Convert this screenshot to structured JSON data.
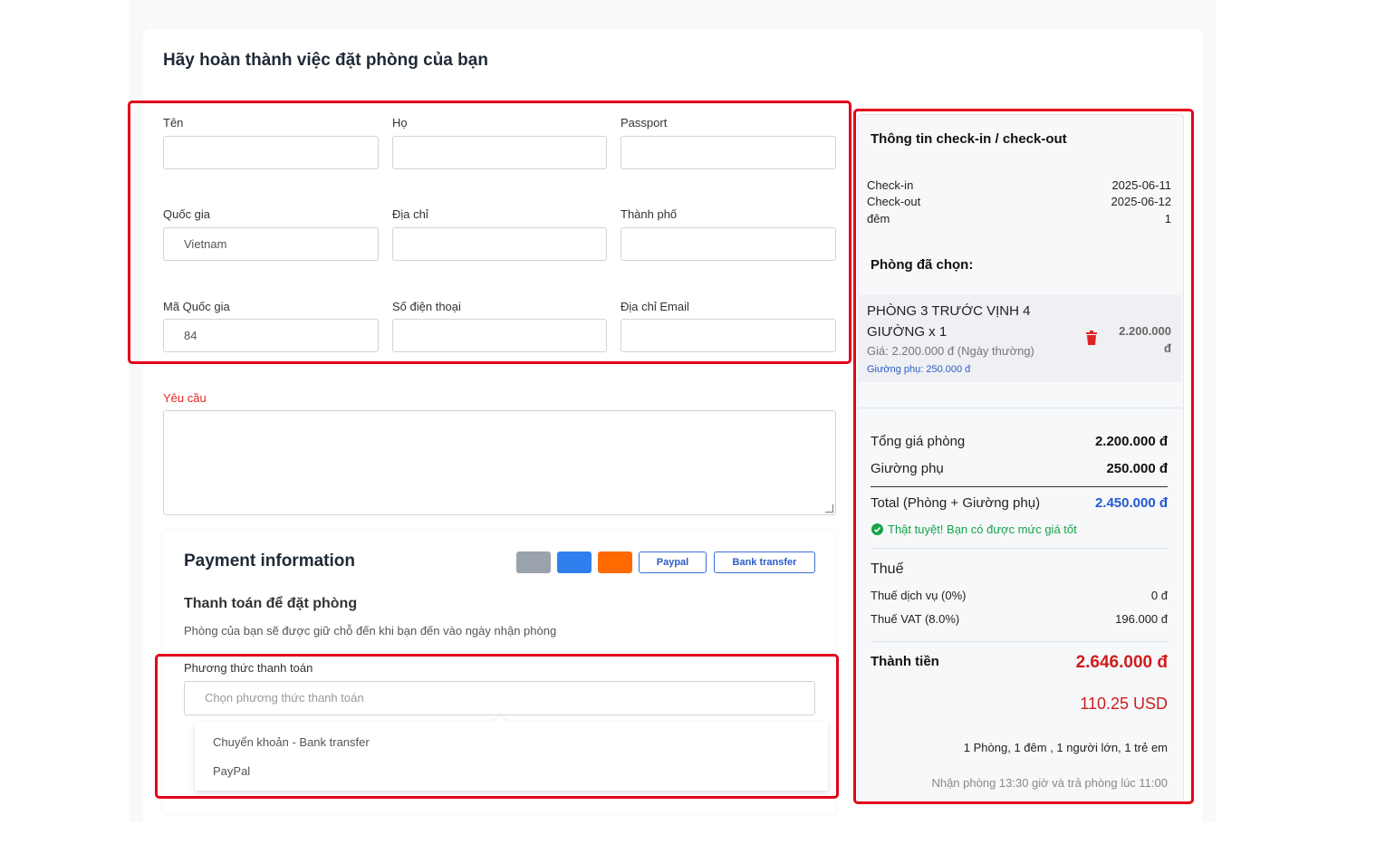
{
  "page": {
    "title": "Hãy hoàn thành việc đặt phòng của bạn"
  },
  "form": {
    "first_name": {
      "label": "Tên",
      "value": ""
    },
    "last_name": {
      "label": "Họ",
      "value": ""
    },
    "passport": {
      "label": "Passport",
      "value": ""
    },
    "country": {
      "label": "Quốc gia",
      "value": "Vietnam"
    },
    "address": {
      "label": "Địa chỉ",
      "value": ""
    },
    "city": {
      "label": "Thành phố",
      "value": ""
    },
    "country_code": {
      "label": "Mã Quốc gia",
      "value": "84"
    },
    "phone": {
      "label": "Số điện thoại",
      "value": ""
    },
    "email": {
      "label": "Địa chỉ Email",
      "value": ""
    },
    "request": {
      "label": "Yêu cầu",
      "value": ""
    }
  },
  "payment": {
    "heading": "Payment information",
    "methods_chips": [
      "Paypal",
      "Bank transfer"
    ],
    "subheading": "Thanh toán để đặt phòng",
    "note": "Phòng của bạn sẽ được giữ chỗ đến khi bạn đến vào ngày nhận phòng",
    "method_label": "Phương thức thanh toán",
    "method_placeholder": "Chọn phương thức thanh toán",
    "options": [
      "Chuyển khoản - Bank transfer",
      "PayPal"
    ],
    "colors": {
      "gray_chip": "#9aa2ad",
      "blue_chip": "#2f80ed",
      "orange_chip": "#ff6a00"
    }
  },
  "summary": {
    "heading": "Thông tin check-in / check-out",
    "checkin_label": "Check-in",
    "checkin_value": "2025-06-11",
    "checkout_label": "Check-out",
    "checkout_value": "2025-06-12",
    "nights_label": "đêm",
    "nights_value": "1",
    "rooms_heading": "Phòng đã chọn:",
    "room_name_line1": "PHÒNG 3 TRƯỚC VỊNH 4",
    "room_name_line2": "GIƯỜNG x 1",
    "room_price_note": "Giá: 2.200.000 đ (Ngày thường)",
    "room_extra_bed_note": "Giường phụ: 250.000 đ",
    "room_price_line1": "2.200.000",
    "room_price_line2": "đ",
    "total_room_label": "Tổng giá phòng",
    "total_room_value": "2.200.000 đ",
    "extra_bed_label": "Giường phụ",
    "extra_bed_value": "250.000 đ",
    "total_label": "Total (Phòng + Giường phụ)",
    "total_value": "2.450.000 đ",
    "good_price_msg": "Thật tuyệt! Bạn có được mức giá tốt",
    "tax_heading": "Thuế",
    "service_tax_label": "Thuế dịch vụ (0%)",
    "service_tax_value": "0 đ",
    "vat_label": "Thuế VAT (8.0%)",
    "vat_value": "196.000 đ",
    "grand_total_label": "Thành tiền",
    "grand_total_value": "2.646.000 đ",
    "grand_total_usd": "110.25 USD",
    "occupancy": "1 Phòng, 1 đêm , 1 người lớn, 1 trẻ em",
    "checkin_time_note": "Nhận phòng 13:30 giờ và trả phòng lúc 11:00"
  }
}
